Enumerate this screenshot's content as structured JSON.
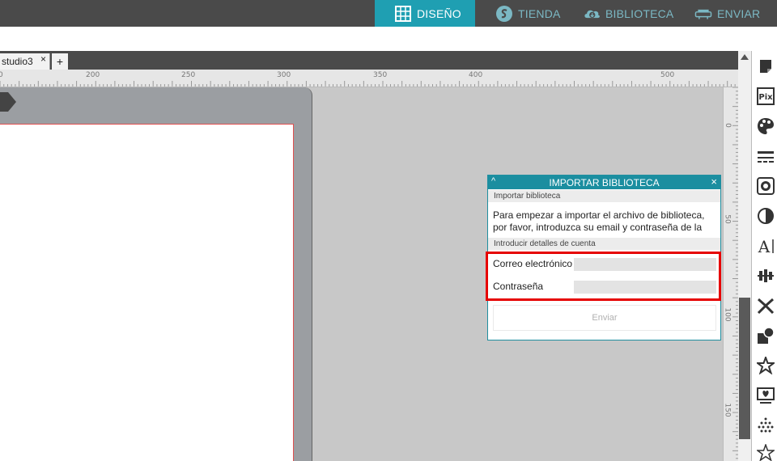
{
  "nav": {
    "tabs": [
      {
        "label": "DISEÑO",
        "icon": "grid-icon"
      },
      {
        "label": "TIENDA",
        "icon": "silhouette-store-icon"
      },
      {
        "label": "BIBLIOTECA",
        "icon": "cloud-download-icon"
      },
      {
        "label": "ENVIAR",
        "icon": "cutter-icon"
      }
    ],
    "active_color": "#1f9fb2"
  },
  "document": {
    "tab_label": "studio3",
    "close_label": "×",
    "add_label": "+"
  },
  "rulers": {
    "horizontal_labels": [
      "0",
      "200",
      "250",
      "300",
      "350",
      "400",
      "500"
    ],
    "vertical_labels": [
      "0",
      "50",
      "100",
      "150"
    ]
  },
  "dialog": {
    "title": "IMPORTAR BIBLIOTECA",
    "collapse_label": "^",
    "close_label": "×",
    "section_import": "Importar biblioteca",
    "description": "Para empezar a importar el archivo de biblioteca, por favor, introduzca su email y contraseña de la",
    "section_details": "Introducir detalles de cuenta",
    "email_label": "Correo electrónico",
    "email_value": "",
    "password_label": "Contraseña",
    "password_value": "",
    "send_label": "Enviar"
  },
  "tools": [
    "page-setup-icon",
    "pixscan-icon",
    "fill-color-icon",
    "line-style-icon",
    "image-effects-icon",
    "transparency-icon",
    "text-style-icon",
    "align-icon",
    "replicate-icon",
    "modify-icon",
    "design-store-icon",
    "library-icon",
    "sketch-icon",
    "star-icon"
  ],
  "colors": {
    "accent": "#1b8ea0",
    "highlight": "#e60000"
  }
}
